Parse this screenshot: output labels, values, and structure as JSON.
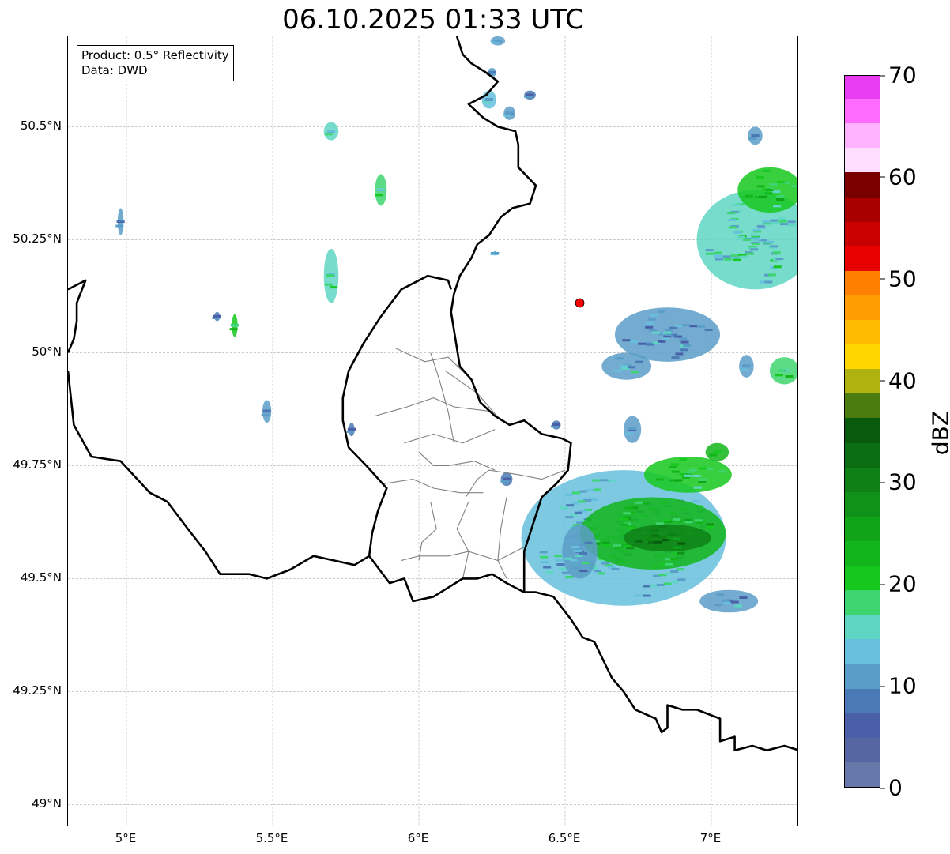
{
  "title": "06.10.2025 01:33 UTC",
  "info": {
    "product": "Product: 0.5° Reflectivity",
    "data": "Data: DWD"
  },
  "map": {
    "lon_range": [
      4.8,
      7.3
    ],
    "lat_range": [
      48.95,
      50.7
    ],
    "x_ticks": [
      {
        "value": 5.0,
        "label": "5°E"
      },
      {
        "value": 5.5,
        "label": "5.5°E"
      },
      {
        "value": 6.0,
        "label": "6°E"
      },
      {
        "value": 6.5,
        "label": "6.5°E"
      },
      {
        "value": 7.0,
        "label": "7°E"
      }
    ],
    "y_ticks": [
      {
        "value": 50.5,
        "label": "50.5°N"
      },
      {
        "value": 50.25,
        "label": "50.25°N"
      },
      {
        "value": 50.0,
        "label": "50°N"
      },
      {
        "value": 49.75,
        "label": "49.75°N"
      },
      {
        "value": 49.5,
        "label": "49.5°N"
      },
      {
        "value": 49.25,
        "label": "49.25°N"
      },
      {
        "value": 49.0,
        "label": "49°N"
      }
    ],
    "gridlines": true,
    "radar_site": {
      "lon": 6.55,
      "lat": 50.11,
      "color": "#ff0000"
    },
    "borders": [
      [
        [
          6.13,
          50.7
        ],
        [
          6.15,
          50.66
        ],
        [
          6.18,
          50.64
        ],
        [
          6.23,
          50.62
        ],
        [
          6.27,
          50.6
        ],
        [
          6.23,
          50.57
        ],
        [
          6.17,
          50.55
        ],
        [
          6.22,
          50.52
        ],
        [
          6.27,
          50.5
        ],
        [
          6.33,
          50.49
        ],
        [
          6.34,
          50.46
        ],
        [
          6.34,
          50.41
        ],
        [
          6.4,
          50.37
        ],
        [
          6.38,
          50.33
        ],
        [
          6.32,
          50.32
        ],
        [
          6.28,
          50.3
        ],
        [
          6.24,
          50.26
        ],
        [
          6.2,
          50.24
        ],
        [
          6.18,
          50.21
        ],
        [
          6.14,
          50.17
        ],
        [
          6.12,
          50.13
        ],
        [
          6.11,
          50.09
        ],
        [
          6.12,
          50.05
        ],
        [
          6.13,
          50.01
        ],
        [
          6.14,
          49.97
        ],
        [
          6.18,
          49.94
        ],
        [
          6.21,
          49.89
        ],
        [
          6.26,
          49.86
        ],
        [
          6.31,
          49.84
        ],
        [
          6.36,
          49.85
        ],
        [
          6.42,
          49.82
        ],
        [
          6.49,
          49.81
        ],
        [
          6.52,
          49.8
        ],
        [
          6.51,
          49.74
        ],
        [
          6.47,
          49.71
        ],
        [
          6.42,
          49.68
        ],
        [
          6.4,
          49.64
        ],
        [
          6.38,
          49.6
        ],
        [
          6.36,
          49.56
        ],
        [
          6.36,
          49.51
        ],
        [
          6.36,
          49.47
        ]
      ],
      [
        [
          6.36,
          49.47
        ],
        [
          6.4,
          49.47
        ],
        [
          6.46,
          49.46
        ],
        [
          6.52,
          49.41
        ],
        [
          6.56,
          49.37
        ],
        [
          6.6,
          49.36
        ],
        [
          6.66,
          49.28
        ],
        [
          6.7,
          49.25
        ],
        [
          6.74,
          49.21
        ],
        [
          6.81,
          49.19
        ],
        [
          6.83,
          49.16
        ],
        [
          6.85,
          49.17
        ],
        [
          6.85,
          49.22
        ],
        [
          6.9,
          49.21
        ],
        [
          6.95,
          49.21
        ],
        [
          7.03,
          49.19
        ],
        [
          7.03,
          49.14
        ],
        [
          7.08,
          49.15
        ],
        [
          7.08,
          49.12
        ],
        [
          7.14,
          49.13
        ],
        [
          7.19,
          49.12
        ],
        [
          7.25,
          49.13
        ],
        [
          7.3,
          49.12
        ]
      ],
      [
        [
          6.36,
          49.47
        ],
        [
          6.3,
          49.49
        ],
        [
          6.25,
          49.51
        ],
        [
          6.2,
          49.5
        ],
        [
          6.15,
          49.5
        ],
        [
          6.1,
          49.48
        ],
        [
          6.05,
          49.46
        ],
        [
          5.98,
          49.45
        ],
        [
          5.95,
          49.5
        ],
        [
          5.9,
          49.49
        ],
        [
          5.83,
          49.55
        ],
        [
          5.78,
          49.53
        ],
        [
          5.71,
          49.54
        ],
        [
          5.64,
          49.55
        ],
        [
          5.56,
          49.52
        ],
        [
          5.48,
          49.5
        ],
        [
          5.42,
          49.51
        ],
        [
          5.32,
          49.51
        ],
        [
          5.27,
          49.56
        ],
        [
          5.21,
          49.61
        ],
        [
          5.14,
          49.67
        ],
        [
          5.08,
          49.69
        ],
        [
          4.98,
          49.76
        ],
        [
          4.88,
          49.77
        ],
        [
          4.82,
          49.84
        ],
        [
          4.8,
          49.96
        ]
      ],
      [
        [
          5.83,
          49.55
        ],
        [
          5.84,
          49.6
        ],
        [
          5.86,
          49.65
        ],
        [
          5.89,
          49.7
        ],
        [
          5.82,
          49.75
        ],
        [
          5.76,
          49.79
        ],
        [
          5.74,
          49.85
        ],
        [
          5.74,
          49.9
        ],
        [
          5.76,
          49.96
        ],
        [
          5.81,
          50.02
        ],
        [
          5.84,
          50.05
        ],
        [
          5.87,
          50.08
        ],
        [
          5.94,
          50.14
        ],
        [
          6.03,
          50.17
        ],
        [
          6.1,
          50.16
        ],
        [
          6.11,
          50.14
        ]
      ],
      [
        [
          4.8,
          50.14
        ],
        [
          4.86,
          50.16
        ],
        [
          4.83,
          50.11
        ],
        [
          4.83,
          50.07
        ],
        [
          4.82,
          50.03
        ],
        [
          4.8,
          50.0
        ]
      ]
    ],
    "districts": [
      [
        [
          5.92,
          50.01
        ],
        [
          6.02,
          49.98
        ],
        [
          6.1,
          49.99
        ],
        [
          6.18,
          49.94
        ]
      ],
      [
        [
          6.04,
          50.0
        ],
        [
          6.07,
          49.94
        ],
        [
          6.1,
          49.87
        ],
        [
          6.12,
          49.8
        ]
      ],
      [
        [
          6.09,
          49.96
        ],
        [
          6.2,
          49.91
        ],
        [
          6.28,
          49.85
        ]
      ],
      [
        [
          5.85,
          49.86
        ],
        [
          5.96,
          49.88
        ],
        [
          6.05,
          49.9
        ],
        [
          6.12,
          49.88
        ],
        [
          6.25,
          49.87
        ]
      ],
      [
        [
          5.95,
          49.8
        ],
        [
          6.05,
          49.82
        ],
        [
          6.15,
          49.8
        ],
        [
          6.26,
          49.83
        ]
      ],
      [
        [
          6.0,
          49.78
        ],
        [
          6.05,
          49.75
        ],
        [
          6.1,
          49.75
        ],
        [
          6.19,
          49.76
        ],
        [
          6.26,
          49.74
        ]
      ],
      [
        [
          5.88,
          49.71
        ],
        [
          5.98,
          49.72
        ],
        [
          6.05,
          49.7
        ],
        [
          6.14,
          49.69
        ],
        [
          6.22,
          49.69
        ]
      ],
      [
        [
          6.16,
          49.68
        ],
        [
          6.2,
          49.72
        ],
        [
          6.24,
          49.74
        ],
        [
          6.34,
          49.73
        ],
        [
          6.42,
          49.72
        ],
        [
          6.5,
          49.74
        ]
      ],
      [
        [
          6.04,
          49.67
        ],
        [
          6.06,
          49.61
        ],
        [
          6.01,
          49.58
        ],
        [
          6.0,
          49.54
        ]
      ],
      [
        [
          6.17,
          49.67
        ],
        [
          6.13,
          49.61
        ],
        [
          6.17,
          49.56
        ],
        [
          6.15,
          49.5
        ]
      ],
      [
        [
          6.3,
          49.68
        ],
        [
          6.28,
          49.61
        ],
        [
          6.27,
          49.54
        ],
        [
          6.3,
          49.5
        ]
      ],
      [
        [
          5.94,
          49.54
        ],
        [
          6.0,
          49.55
        ],
        [
          6.05,
          49.55
        ],
        [
          6.1,
          49.55
        ],
        [
          6.17,
          49.56
        ],
        [
          6.27,
          49.54
        ],
        [
          6.36,
          49.57
        ]
      ]
    ],
    "echo_cells": [
      {
        "lon": 6.27,
        "lat": 50.69,
        "w": 0.05,
        "h": 0.02,
        "dbz": 12
      },
      {
        "lon": 6.25,
        "lat": 50.62,
        "w": 0.03,
        "h": 0.02,
        "dbz": 10
      },
      {
        "lon": 6.24,
        "lat": 50.56,
        "w": 0.05,
        "h": 0.04,
        "dbz": 14
      },
      {
        "lon": 6.31,
        "lat": 50.53,
        "w": 0.04,
        "h": 0.03,
        "dbz": 12
      },
      {
        "lon": 6.38,
        "lat": 50.57,
        "w": 0.04,
        "h": 0.02,
        "dbz": 8
      },
      {
        "lon": 5.7,
        "lat": 50.49,
        "w": 0.05,
        "h": 0.04,
        "dbz": 15
      },
      {
        "lon": 5.87,
        "lat": 50.36,
        "w": 0.04,
        "h": 0.07,
        "dbz": 18
      },
      {
        "lon": 4.98,
        "lat": 50.29,
        "w": 0.02,
        "h": 0.06,
        "dbz": 10
      },
      {
        "lon": 5.7,
        "lat": 50.17,
        "w": 0.05,
        "h": 0.12,
        "dbz": 16
      },
      {
        "lon": 5.37,
        "lat": 50.06,
        "w": 0.02,
        "h": 0.05,
        "dbz": 20
      },
      {
        "lon": 5.31,
        "lat": 50.08,
        "w": 0.02,
        "h": 0.02,
        "dbz": 8
      },
      {
        "lon": 5.48,
        "lat": 49.87,
        "w": 0.03,
        "h": 0.05,
        "dbz": 10
      },
      {
        "lon": 5.77,
        "lat": 49.83,
        "w": 0.02,
        "h": 0.03,
        "dbz": 8
      },
      {
        "lon": 6.26,
        "lat": 50.22,
        "w": 0.01,
        "h": 0.01,
        "dbz": 12
      },
      {
        "lon": 6.85,
        "lat": 50.04,
        "w": 0.36,
        "h": 0.12,
        "dbz": 10
      },
      {
        "lon": 6.71,
        "lat": 49.97,
        "w": 0.17,
        "h": 0.06,
        "dbz": 12
      },
      {
        "lon": 6.73,
        "lat": 49.83,
        "w": 0.06,
        "h": 0.06,
        "dbz": 12
      },
      {
        "lon": 7.15,
        "lat": 50.25,
        "w": 0.4,
        "h": 0.22,
        "dbz": 15
      },
      {
        "lon": 7.2,
        "lat": 50.36,
        "w": 0.22,
        "h": 0.1,
        "dbz": 20
      },
      {
        "lon": 7.15,
        "lat": 50.48,
        "w": 0.05,
        "h": 0.04,
        "dbz": 10
      },
      {
        "lon": 7.25,
        "lat": 49.96,
        "w": 0.1,
        "h": 0.06,
        "dbz": 18
      },
      {
        "lon": 7.12,
        "lat": 49.97,
        "w": 0.05,
        "h": 0.05,
        "dbz": 12
      },
      {
        "lon": 6.7,
        "lat": 49.59,
        "w": 0.7,
        "h": 0.3,
        "dbz": 14
      },
      {
        "lon": 6.8,
        "lat": 49.6,
        "w": 0.5,
        "h": 0.16,
        "dbz": 22
      },
      {
        "lon": 6.85,
        "lat": 49.59,
        "w": 0.3,
        "h": 0.06,
        "dbz": 30
      },
      {
        "lon": 6.92,
        "lat": 49.73,
        "w": 0.3,
        "h": 0.08,
        "dbz": 20
      },
      {
        "lon": 7.02,
        "lat": 49.78,
        "w": 0.08,
        "h": 0.04,
        "dbz": 22
      },
      {
        "lon": 6.55,
        "lat": 49.56,
        "w": 0.12,
        "h": 0.12,
        "dbz": 12
      },
      {
        "lon": 7.06,
        "lat": 49.45,
        "w": 0.2,
        "h": 0.05,
        "dbz": 10
      },
      {
        "lon": 6.3,
        "lat": 49.72,
        "w": 0.04,
        "h": 0.03,
        "dbz": 8
      },
      {
        "lon": 6.47,
        "lat": 49.84,
        "w": 0.03,
        "h": 0.02,
        "dbz": 8
      }
    ]
  },
  "colorbar": {
    "label": "dBZ",
    "min": 0,
    "max": 70,
    "ticks": [
      {
        "value": 0,
        "label": "0"
      },
      {
        "value": 10,
        "label": "10"
      },
      {
        "value": 20,
        "label": "20"
      },
      {
        "value": 30,
        "label": "30"
      },
      {
        "value": 40,
        "label": "40"
      },
      {
        "value": 50,
        "label": "50"
      },
      {
        "value": 60,
        "label": "60"
      },
      {
        "value": 70,
        "label": "70"
      }
    ],
    "colors": [
      "#6677aa",
      "#5566a3",
      "#4a5fa8",
      "#4a7ab5",
      "#5a9dc8",
      "#66c0dd",
      "#5fd6c3",
      "#3dd56f",
      "#16c81e",
      "#12b61a",
      "#10a418",
      "#0f9217",
      "#0e8016",
      "#0b6e12",
      "#085b0d",
      "#4a7c10",
      "#b0b210",
      "#ffd700",
      "#ffbb00",
      "#ff9e00",
      "#ff8000",
      "#e60000",
      "#c80000",
      "#a80000",
      "#7a0000",
      "#ffdfff",
      "#ffb3ff",
      "#ff6bff",
      "#e83cf0"
    ]
  }
}
